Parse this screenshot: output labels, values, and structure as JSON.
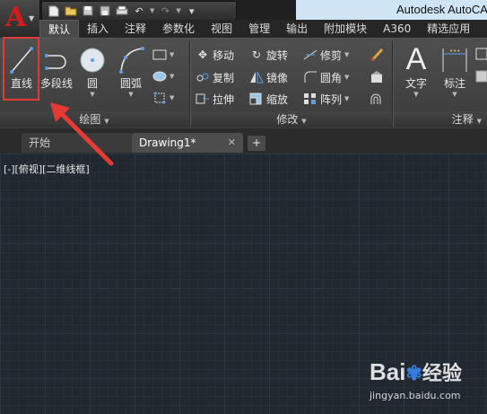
{
  "app": {
    "title": "Autodesk AutoCA"
  },
  "tabs": [
    "默认",
    "插入",
    "注释",
    "参数化",
    "视图",
    "管理",
    "输出",
    "附加模块",
    "A360",
    "精选应用"
  ],
  "draw_panel": {
    "buttons": [
      "直线",
      "多段线",
      "圆",
      "圆弧"
    ],
    "title": "绘图"
  },
  "modify_panel": {
    "items": [
      "移动",
      "旋转",
      "修剪",
      "复制",
      "镜像",
      "圆角",
      "拉伸",
      "缩放",
      "阵列"
    ],
    "title": "修改"
  },
  "annotation_panel": {
    "buttons": [
      "文字",
      "标注"
    ],
    "title": "注释"
  },
  "file_tabs": [
    "开始",
    "Drawing1*"
  ],
  "viewport": {
    "label": "[-][俯视][二维线框]"
  },
  "watermark": {
    "brand": "Bai",
    "brand_suffix": "经验",
    "url": "jingyan.baidu.com"
  },
  "colors": {
    "accent": "#e53935",
    "title_bg": "#cfe5f6"
  }
}
